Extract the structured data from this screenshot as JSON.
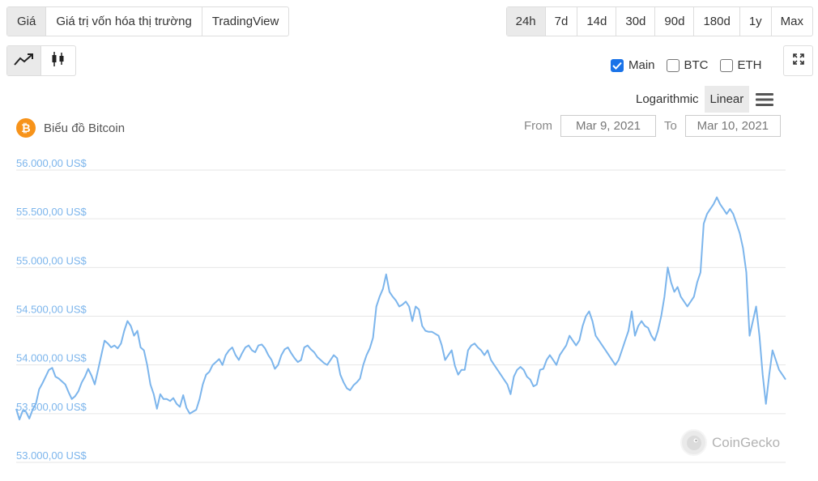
{
  "tabs": [
    "Giá",
    "Giá trị vốn hóa thị trường",
    "TradingView"
  ],
  "ranges": [
    "24h",
    "7d",
    "14d",
    "30d",
    "90d",
    "180d",
    "1y",
    "Max"
  ],
  "series_toggles": [
    {
      "label": "Main",
      "checked": true
    },
    {
      "label": "BTC",
      "checked": false
    },
    {
      "label": "ETH",
      "checked": false
    }
  ],
  "scale": {
    "log": "Logarithmic",
    "linear": "Linear"
  },
  "title": "Biểu đồ Bitcoin",
  "coin_symbol": "₿",
  "dates": {
    "from_label": "From",
    "from": "Mar 9, 2021",
    "to_label": "To",
    "to": "Mar 10, 2021"
  },
  "watermark": "CoinGecko",
  "colors": {
    "line": "#7cb5ec",
    "axis_label": "#7cb5ec",
    "grid": "#e6e6e6",
    "accent": "#1a73e8",
    "bitcoin": "#f7931a"
  },
  "icons": {
    "line_chart": "trend-line-icon",
    "candlestick": "candlestick-icon",
    "expand": "expand-icon",
    "menu": "hamburger-menu-icon"
  },
  "chart_data": {
    "type": "line",
    "series": [
      {
        "name": "Main",
        "values": [
          53550,
          53440,
          53530,
          53520,
          53450,
          53540,
          53600,
          53750,
          53810,
          53880,
          53950,
          53970,
          53880,
          53860,
          53830,
          53800,
          53720,
          53650,
          53680,
          53730,
          53820,
          53880,
          53960,
          53890,
          53800,
          53950,
          54100,
          54250,
          54220,
          54180,
          54200,
          54170,
          54220,
          54350,
          54450,
          54400,
          54300,
          54350,
          54180,
          54150,
          54000,
          53800,
          53700,
          53550,
          53700,
          53650,
          53650,
          53630,
          53660,
          53600,
          53570,
          53690,
          53560,
          53500,
          53520,
          53540,
          53650,
          53800,
          53900,
          53930,
          54000,
          54030,
          54060,
          54000,
          54100,
          54150,
          54180,
          54100,
          54050,
          54120,
          54180,
          54200,
          54150,
          54130,
          54200,
          54210,
          54170,
          54100,
          54050,
          53960,
          54000,
          54100,
          54160,
          54180,
          54120,
          54070,
          54030,
          54050,
          54180,
          54200,
          54160,
          54130,
          54080,
          54050,
          54020,
          54000,
          54050,
          54100,
          54070,
          53900,
          53820,
          53760,
          53740,
          53790,
          53820,
          53860,
          54000,
          54100,
          54170,
          54280,
          54600,
          54700,
          54780,
          54930,
          54750,
          54700,
          54660,
          54600,
          54620,
          54650,
          54600,
          54450,
          54600,
          54570,
          54400,
          54350,
          54340,
          54340,
          54320,
          54300,
          54200,
          54050,
          54100,
          54150,
          53990,
          53900,
          53950,
          53950,
          54150,
          54200,
          54220,
          54180,
          54150,
          54100,
          54150,
          54050,
          54000,
          53950,
          53900,
          53850,
          53800,
          53700,
          53880,
          53950,
          53980,
          53950,
          53880,
          53850,
          53780,
          53800,
          53950,
          53960,
          54050,
          54100,
          54050,
          54000,
          54100,
          54150,
          54200,
          54300,
          54250,
          54200,
          54250,
          54400,
          54500,
          54550,
          54450,
          54300,
          54250,
          54200,
          54150,
          54100,
          54050,
          54000,
          54050,
          54150,
          54250,
          54350,
          54550,
          54300,
          54400,
          54450,
          54400,
          54380,
          54300,
          54250,
          54350,
          54500,
          54700,
          55000,
          54850,
          54750,
          54800,
          54700,
          54650,
          54600,
          54650,
          54700,
          54850,
          54950,
          55450,
          55550,
          55600,
          55650,
          55720,
          55650,
          55600,
          55550,
          55600,
          55550,
          55450,
          55350,
          55200,
          54950,
          54300,
          54450,
          54600,
          54300,
          53900,
          53600,
          53900,
          54150,
          54050,
          53950,
          53900,
          53850
        ]
      }
    ],
    "ytick_labels": [
      "53.000,00 US$",
      "53.500,00 US$",
      "54.000,00 US$",
      "54.500,00 US$",
      "55.000,00 US$",
      "55.500,00 US$",
      "56.000,00 US$"
    ],
    "yticks": [
      53000,
      53500,
      54000,
      54500,
      55000,
      55500,
      56000
    ],
    "ylim": [
      53000,
      56000
    ],
    "xlabel": "",
    "ylabel": "",
    "grid": true
  }
}
